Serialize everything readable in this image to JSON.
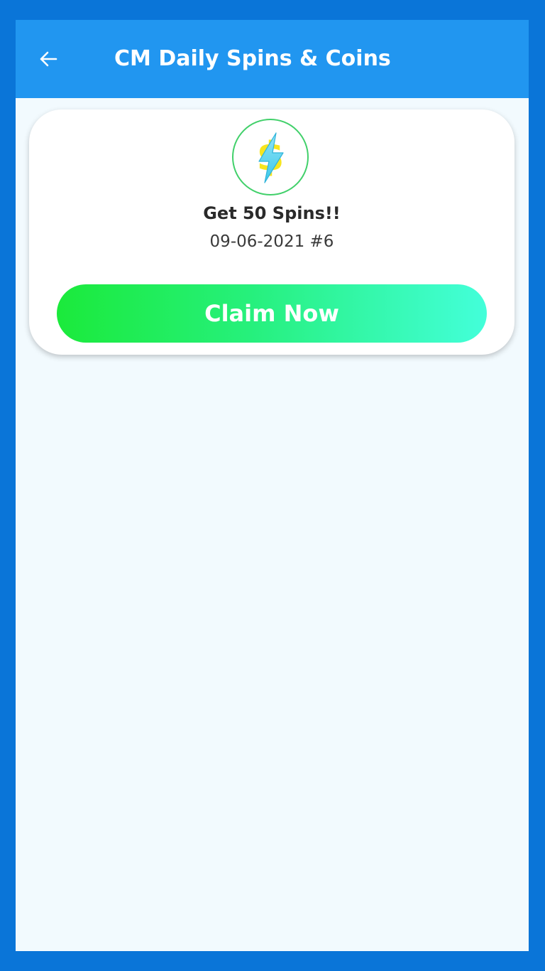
{
  "header": {
    "title": "CM Daily Spins & Coins",
    "back_icon": "arrow-left-icon"
  },
  "reward": {
    "title": "Get 50 Spins!!",
    "date": "09-06-2021 #6",
    "icon": "lightning-coin-icon",
    "claim_label": "Claim Now"
  },
  "colors": {
    "frame": "#0A75D8",
    "app_bar": "#2196F0",
    "background": "#F2FAFE",
    "button_start": "#1BEA3B",
    "button_end": "#43FFDA",
    "badge_border": "#41D06A"
  }
}
